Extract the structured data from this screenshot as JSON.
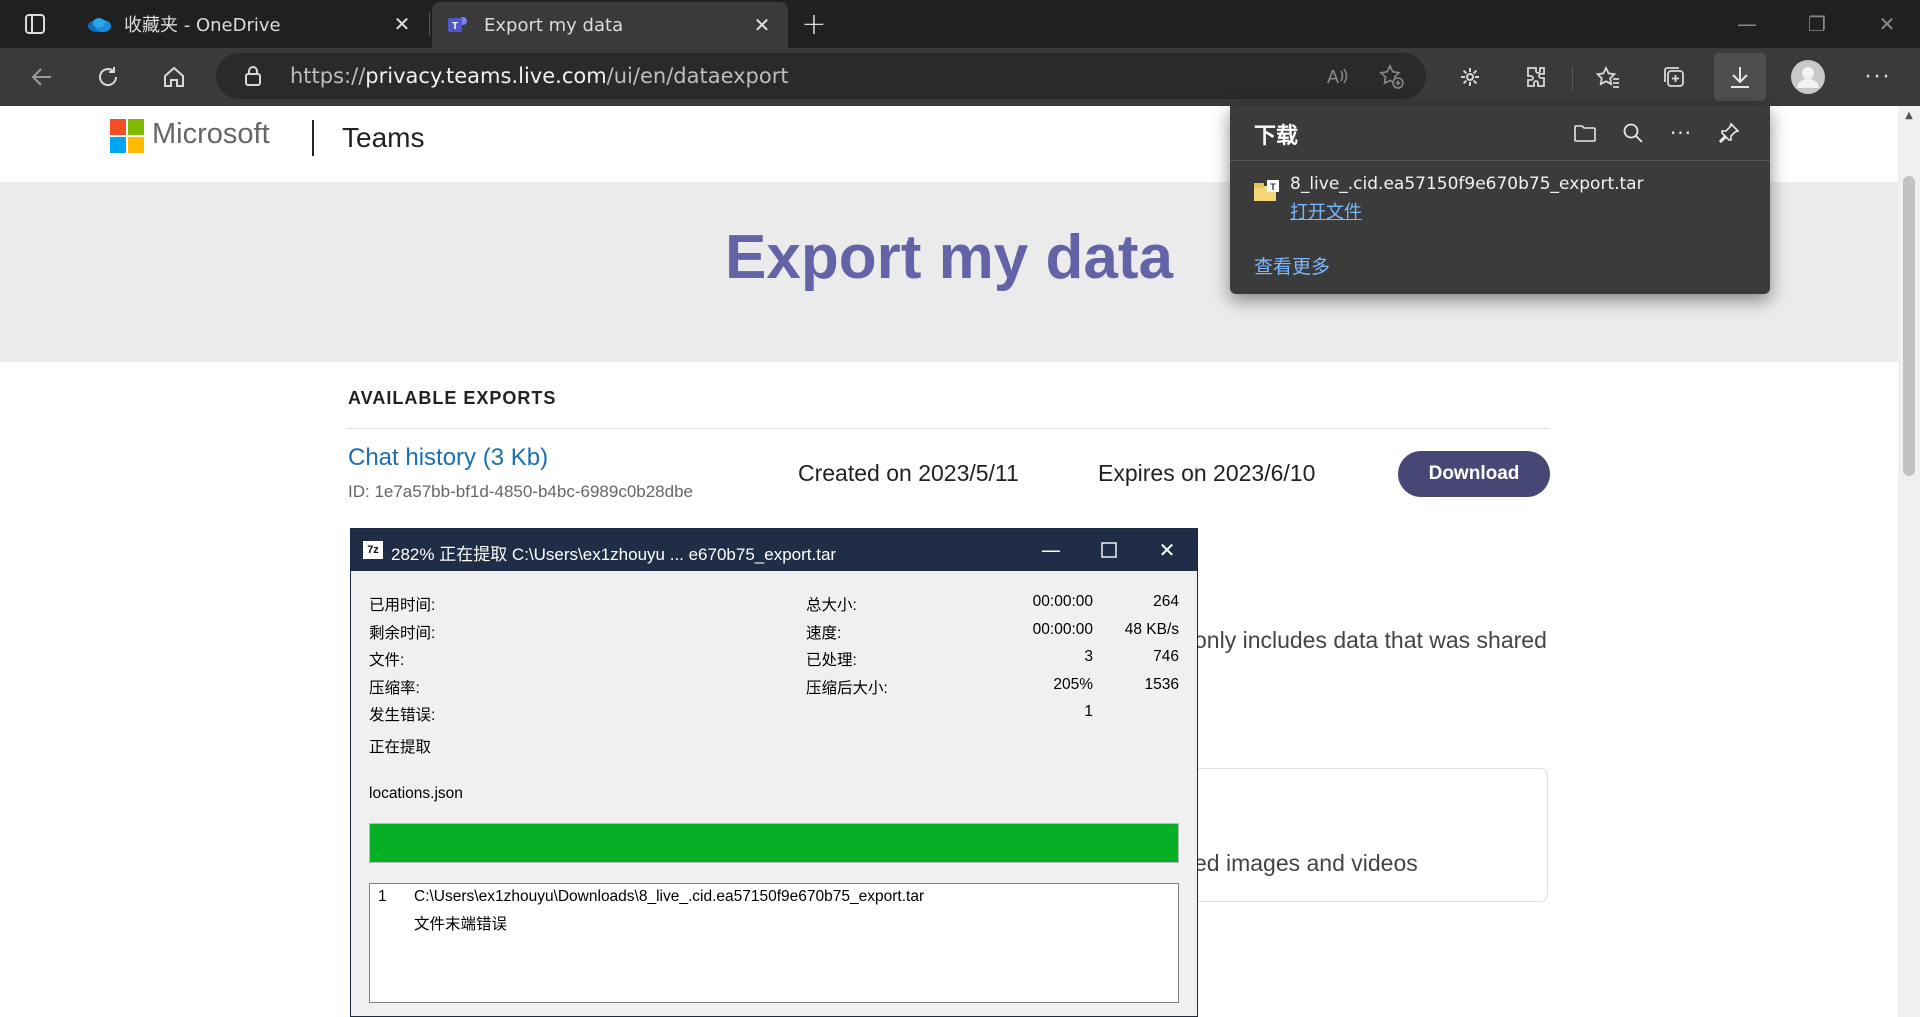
{
  "browser": {
    "tabs": [
      {
        "title": "收藏夹 - OneDrive"
      },
      {
        "title": "Export my data"
      }
    ],
    "url_prefix": "https://",
    "url_host": "privacy.teams.live.com",
    "url_path": "/ui/en/dataexport"
  },
  "site": {
    "brand": "Microsoft",
    "product": "Teams",
    "hero_title": "Export my data",
    "exports_heading": "AVAILABLE EXPORTS",
    "export": {
      "name": "Chat history (3 Kb)",
      "id": "ID: 1e7a57bb-bf1d-4850-b4bc-6989c0b28dbe",
      "created": "Created on 2023/5/11",
      "expires": "Expires on 2023/6/10",
      "download_label": "Download"
    },
    "partial_text_1": "only includes data that was shared",
    "partial_text_2": "ed images and videos"
  },
  "downloads_panel": {
    "title": "下载",
    "filename": "8_live_.cid.ea57150f9e670b75_export.tar",
    "open_label": "打开文件",
    "see_more": "查看更多"
  },
  "zip": {
    "title": "282% 正在提取 C:\\Users\\ex1zhouyu ... e670b75_export.tar",
    "icon_text": "7z",
    "left": [
      {
        "label": "已用时间:",
        "value": "00:00:00"
      },
      {
        "label": "剩余时间:",
        "value": "00:00:00"
      },
      {
        "label": "文件:",
        "value": "3"
      },
      {
        "label": "压缩率:",
        "value": "205%"
      },
      {
        "label": "发生错误:",
        "value": "1"
      }
    ],
    "right": [
      {
        "label": "总大小:",
        "value": "264"
      },
      {
        "label": "速度:",
        "value": "48 KB/s"
      },
      {
        "label": "已处理:",
        "value": "746"
      },
      {
        "label": "压缩后大小:",
        "value": "1536"
      }
    ],
    "status": "正在提取",
    "current_file": "locations.json",
    "progress_percent": 100,
    "log": {
      "number": "1",
      "path": "C:\\Users\\ex1zhouyu\\Downloads\\8_live_.cid.ea57150f9e670b75_export.tar",
      "error": "文件末端错误"
    }
  },
  "colors": {
    "accent": "#6264a7",
    "download_button": "#464775",
    "progress": "#06b025",
    "link": "#1a6fb0"
  }
}
